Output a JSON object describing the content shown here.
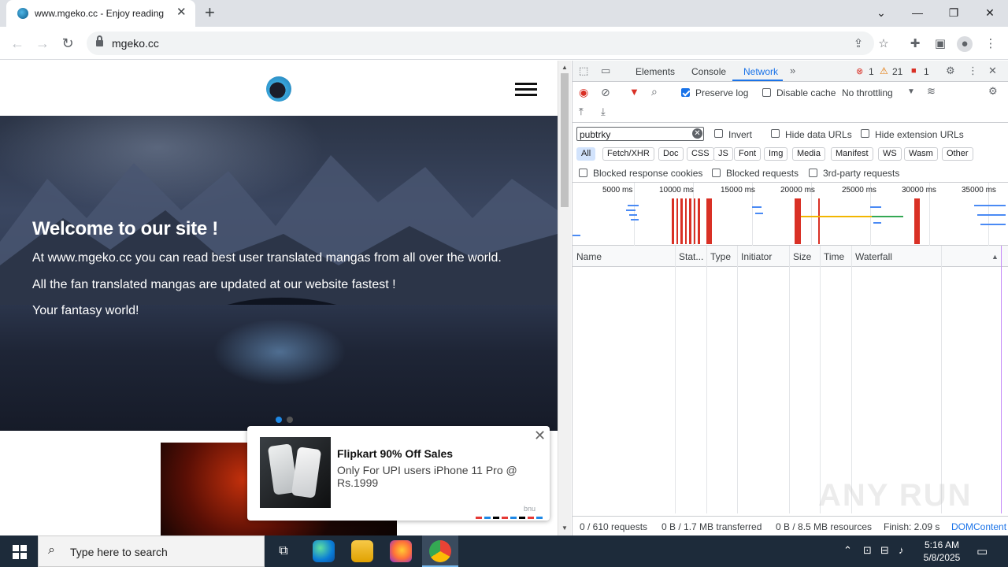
{
  "browser": {
    "tab_title": "www.mgeko.cc - Enjoy reading",
    "url": "mgeko.cc"
  },
  "site": {
    "hero": {
      "heading": "Welcome to our site !",
      "line1": "At www.mgeko.cc you can read best user translated mangas from all over the world.",
      "line2": "All the fan translated mangas are updated at our website fastest !",
      "line3": "Your fantasy world!"
    },
    "ad": {
      "title": "Flipkart 90% Off Sales",
      "description": "Only For UPI users iPhone 11 Pro @ Rs.1999",
      "brand": "bnu"
    }
  },
  "devtools": {
    "tabs": [
      "Elements",
      "Console",
      "Network"
    ],
    "active_tab": "Network",
    "badges": {
      "errors": "1",
      "warnings": "21",
      "issues": "1"
    },
    "controls": {
      "preserve_log": "Preserve log",
      "preserve_log_checked": true,
      "disable_cache": "Disable cache",
      "disable_cache_checked": false,
      "throttling": "No throttling"
    },
    "filter": {
      "value": "pubtrky",
      "invert": "Invert",
      "hide_data_urls": "Hide data URLs",
      "hide_extension_urls": "Hide extension URLs"
    },
    "type_filters": [
      "All",
      "Fetch/XHR",
      "Doc",
      "CSS",
      "JS",
      "Font",
      "Img",
      "Media",
      "Manifest",
      "WS",
      "Wasm",
      "Other"
    ],
    "extra_filters": {
      "blocked_cookies": "Blocked response cookies",
      "blocked_requests": "Blocked requests",
      "third_party": "3rd-party requests"
    },
    "timeline_ticks": [
      "5000 ms",
      "10000 ms",
      "15000 ms",
      "20000 ms",
      "25000 ms",
      "30000 ms",
      "35000 ms"
    ],
    "columns": [
      "Name",
      "Stat...",
      "Type",
      "Initiator",
      "Size",
      "Time",
      "Waterfall"
    ],
    "status": {
      "requests": "0 / 610 requests",
      "transferred": "0 B / 1.7 MB transferred",
      "resources": "0 B / 8.5 MB resources",
      "finish": "Finish: 2.09 s",
      "dom": "DOMContent"
    }
  },
  "taskbar": {
    "search_placeholder": "Type here to search",
    "time": "5:16 AM",
    "date": "5/8/2025"
  },
  "watermark": "ANY RUN",
  "colors": {
    "accent": "#1a73e8",
    "record_red": "#d93025",
    "taskbar": "#1d2b3a"
  }
}
